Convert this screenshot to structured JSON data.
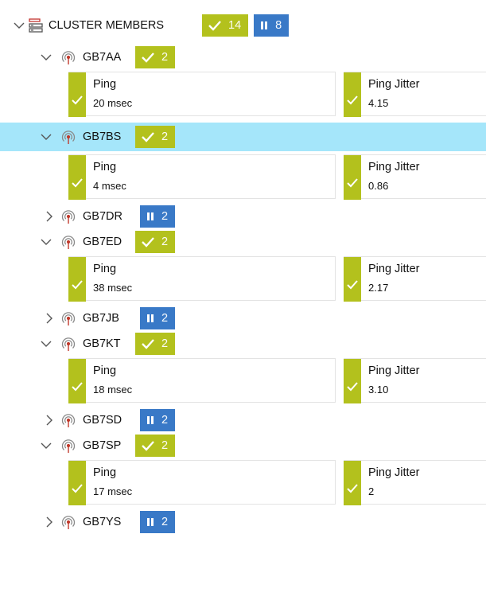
{
  "root": {
    "label": "CLUSTER MEMBERS",
    "up_count": "14",
    "paused_count": "8"
  },
  "nodes": [
    {
      "name": "GB7AA",
      "status": "up",
      "count": "2",
      "expanded": true,
      "selected": false,
      "sensors": [
        {
          "name": "Ping",
          "value": "20 msec"
        },
        {
          "name": "Ping Jitter",
          "value": "4.15"
        }
      ]
    },
    {
      "name": "GB7BS",
      "status": "up",
      "count": "2",
      "expanded": true,
      "selected": true,
      "sensors": [
        {
          "name": "Ping",
          "value": "4 msec"
        },
        {
          "name": "Ping Jitter",
          "value": "0.86"
        }
      ]
    },
    {
      "name": "GB7DR",
      "status": "paused",
      "count": "2",
      "expanded": false,
      "selected": false,
      "sensors": []
    },
    {
      "name": "GB7ED",
      "status": "up",
      "count": "2",
      "expanded": true,
      "selected": false,
      "sensors": [
        {
          "name": "Ping",
          "value": "38 msec"
        },
        {
          "name": "Ping Jitter",
          "value": "2.17"
        }
      ]
    },
    {
      "name": "GB7JB",
      "status": "paused",
      "count": "2",
      "expanded": false,
      "selected": false,
      "sensors": []
    },
    {
      "name": "GB7KT",
      "status": "up",
      "count": "2",
      "expanded": true,
      "selected": false,
      "sensors": [
        {
          "name": "Ping",
          "value": "18 msec"
        },
        {
          "name": "Ping Jitter",
          "value": "3.10"
        }
      ]
    },
    {
      "name": "GB7SD",
      "status": "paused",
      "count": "2",
      "expanded": false,
      "selected": false,
      "sensors": []
    },
    {
      "name": "GB7SP",
      "status": "up",
      "count": "2",
      "expanded": true,
      "selected": false,
      "sensors": [
        {
          "name": "Ping",
          "value": "17 msec"
        },
        {
          "name": "Ping Jitter",
          "value": "2"
        }
      ]
    },
    {
      "name": "GB7YS",
      "status": "paused",
      "count": "2",
      "expanded": false,
      "selected": false,
      "sensors": []
    }
  ],
  "colors": {
    "up": "#b3c11d",
    "paused": "#3979c7",
    "selected_row": "#a5e6fa"
  },
  "icons": {
    "expanded": "chevron-down-icon",
    "collapsed": "chevron-right-icon",
    "root": "cluster-group-icon",
    "node": "antenna-probe-icon",
    "up": "checkmark-icon",
    "paused": "pause-icon"
  }
}
